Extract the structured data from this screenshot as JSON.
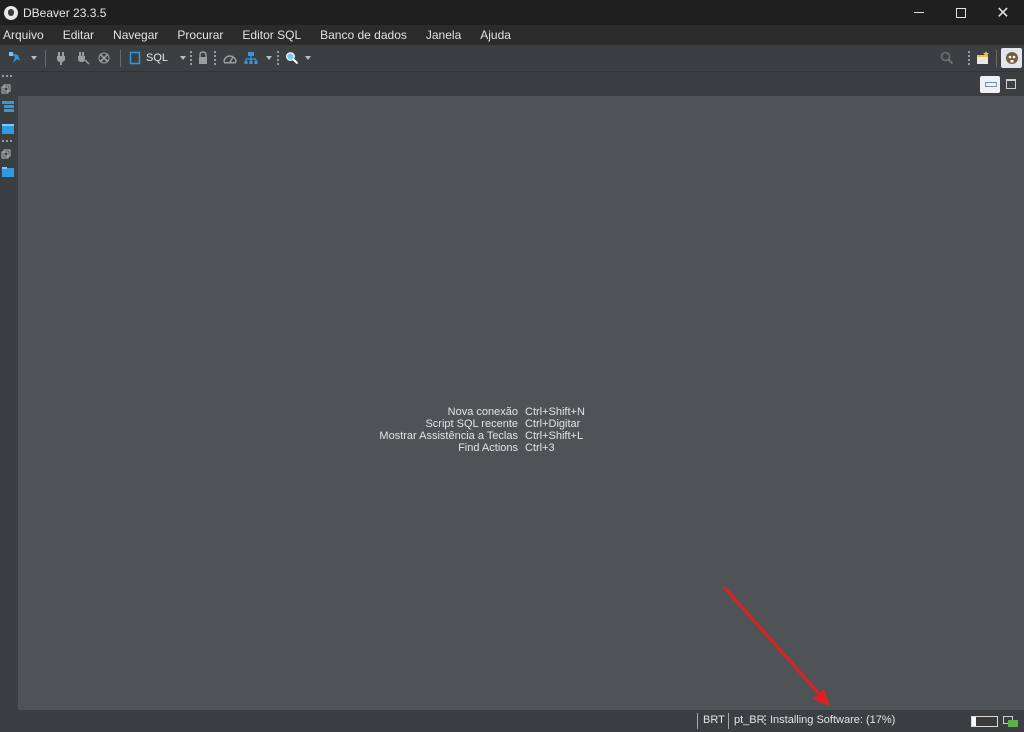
{
  "window": {
    "title": "DBeaver 23.3.5",
    "controls": {
      "minimize": "minimize-icon",
      "maximize": "maximize-icon",
      "close": "close-icon"
    }
  },
  "menu": [
    "Arquivo",
    "Editar",
    "Navegar",
    "Procurar",
    "Editor SQL",
    "Banco de dados",
    "Janela",
    "Ajuda"
  ],
  "toolbar": {
    "sql_label": "SQL",
    "icons": [
      "new-connection-icon",
      "connect-plug-icon",
      "disconnect-plug-icon",
      "invalidate-icon",
      "sql-editor-icon",
      "lock-icon",
      "dashboard-icon",
      "schema-compare-icon",
      "search-icon",
      "perspective-icon",
      "dbeaver-perspective-icon"
    ]
  },
  "welcome": {
    "shortcuts": [
      {
        "label": "Nova conexão",
        "key": "Ctrl+Shift+N"
      },
      {
        "label": "Script SQL recente",
        "key": "Ctrl+Digitar"
      },
      {
        "label": "Mostrar Assistência a Teclas",
        "key": "Ctrl+Shift+L"
      },
      {
        "label": "Find Actions",
        "key": "Ctrl+3"
      }
    ]
  },
  "status": {
    "timezone": "BRT",
    "locale": "pt_BR",
    "task": "Installing Software: (17%)",
    "progress": 0.17
  },
  "colors": {
    "annotation_arrow": "#e02020",
    "accent_blue": "#2f9ae0"
  }
}
